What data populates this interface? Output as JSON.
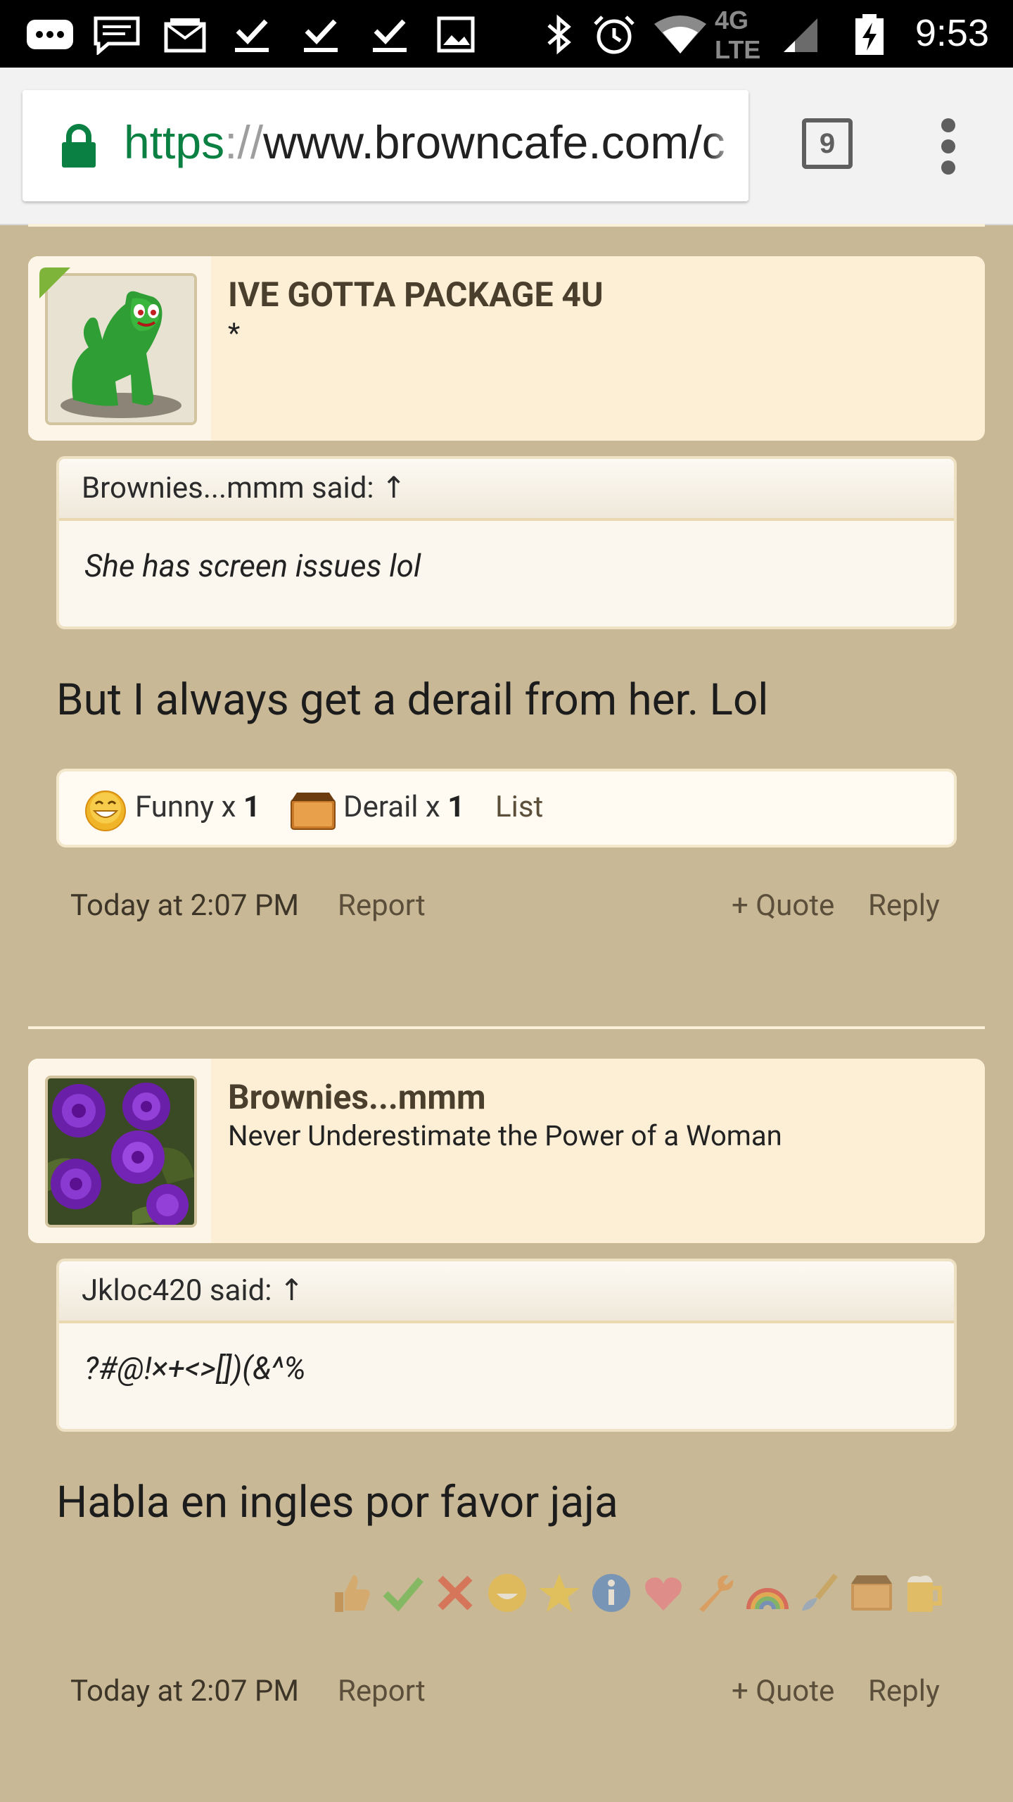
{
  "status_bar": {
    "time": "9:53",
    "network_label": "4G LTE"
  },
  "browser": {
    "url_scheme": "https",
    "url_sep": "://",
    "url_host": "www.browncafe.com/c",
    "tab_count": "9"
  },
  "posts": [
    {
      "user": {
        "name": "IVE GOTTA PACKAGE 4U",
        "title": "*"
      },
      "quote": {
        "author": "Brownies...mmm said: ↑",
        "text": "She has screen issues lol"
      },
      "text": "But I always get a derail from her. Lol",
      "likes": [
        {
          "label": "Funny x ",
          "count": "1"
        },
        {
          "label": "Derail x ",
          "count": "1"
        }
      ],
      "likes_list_link": "List",
      "footer": {
        "date": "Today at 2:07 PM",
        "report": "Report",
        "quote": "+ Quote",
        "reply": "Reply"
      }
    },
    {
      "user": {
        "name": "Brownies...mmm",
        "title": "Never Underestimate the Power of a Woman"
      },
      "quote": {
        "author": "Jkloc420 said: ↑",
        "text": "?#@!×+<>[])(&^%"
      },
      "text": "Habla en ingles por favor jaja",
      "reactions": [
        "thumbs-up-icon",
        "check-icon",
        "x-icon",
        "laugh-icon",
        "star-icon",
        "info-icon",
        "heart-icon",
        "wrench-icon",
        "rainbow-icon",
        "brush-icon",
        "box-icon",
        "beer-icon"
      ],
      "footer": {
        "date": "Today at 2:07 PM",
        "report": "Report",
        "quote": "+ Quote",
        "reply": "Reply"
      }
    }
  ]
}
